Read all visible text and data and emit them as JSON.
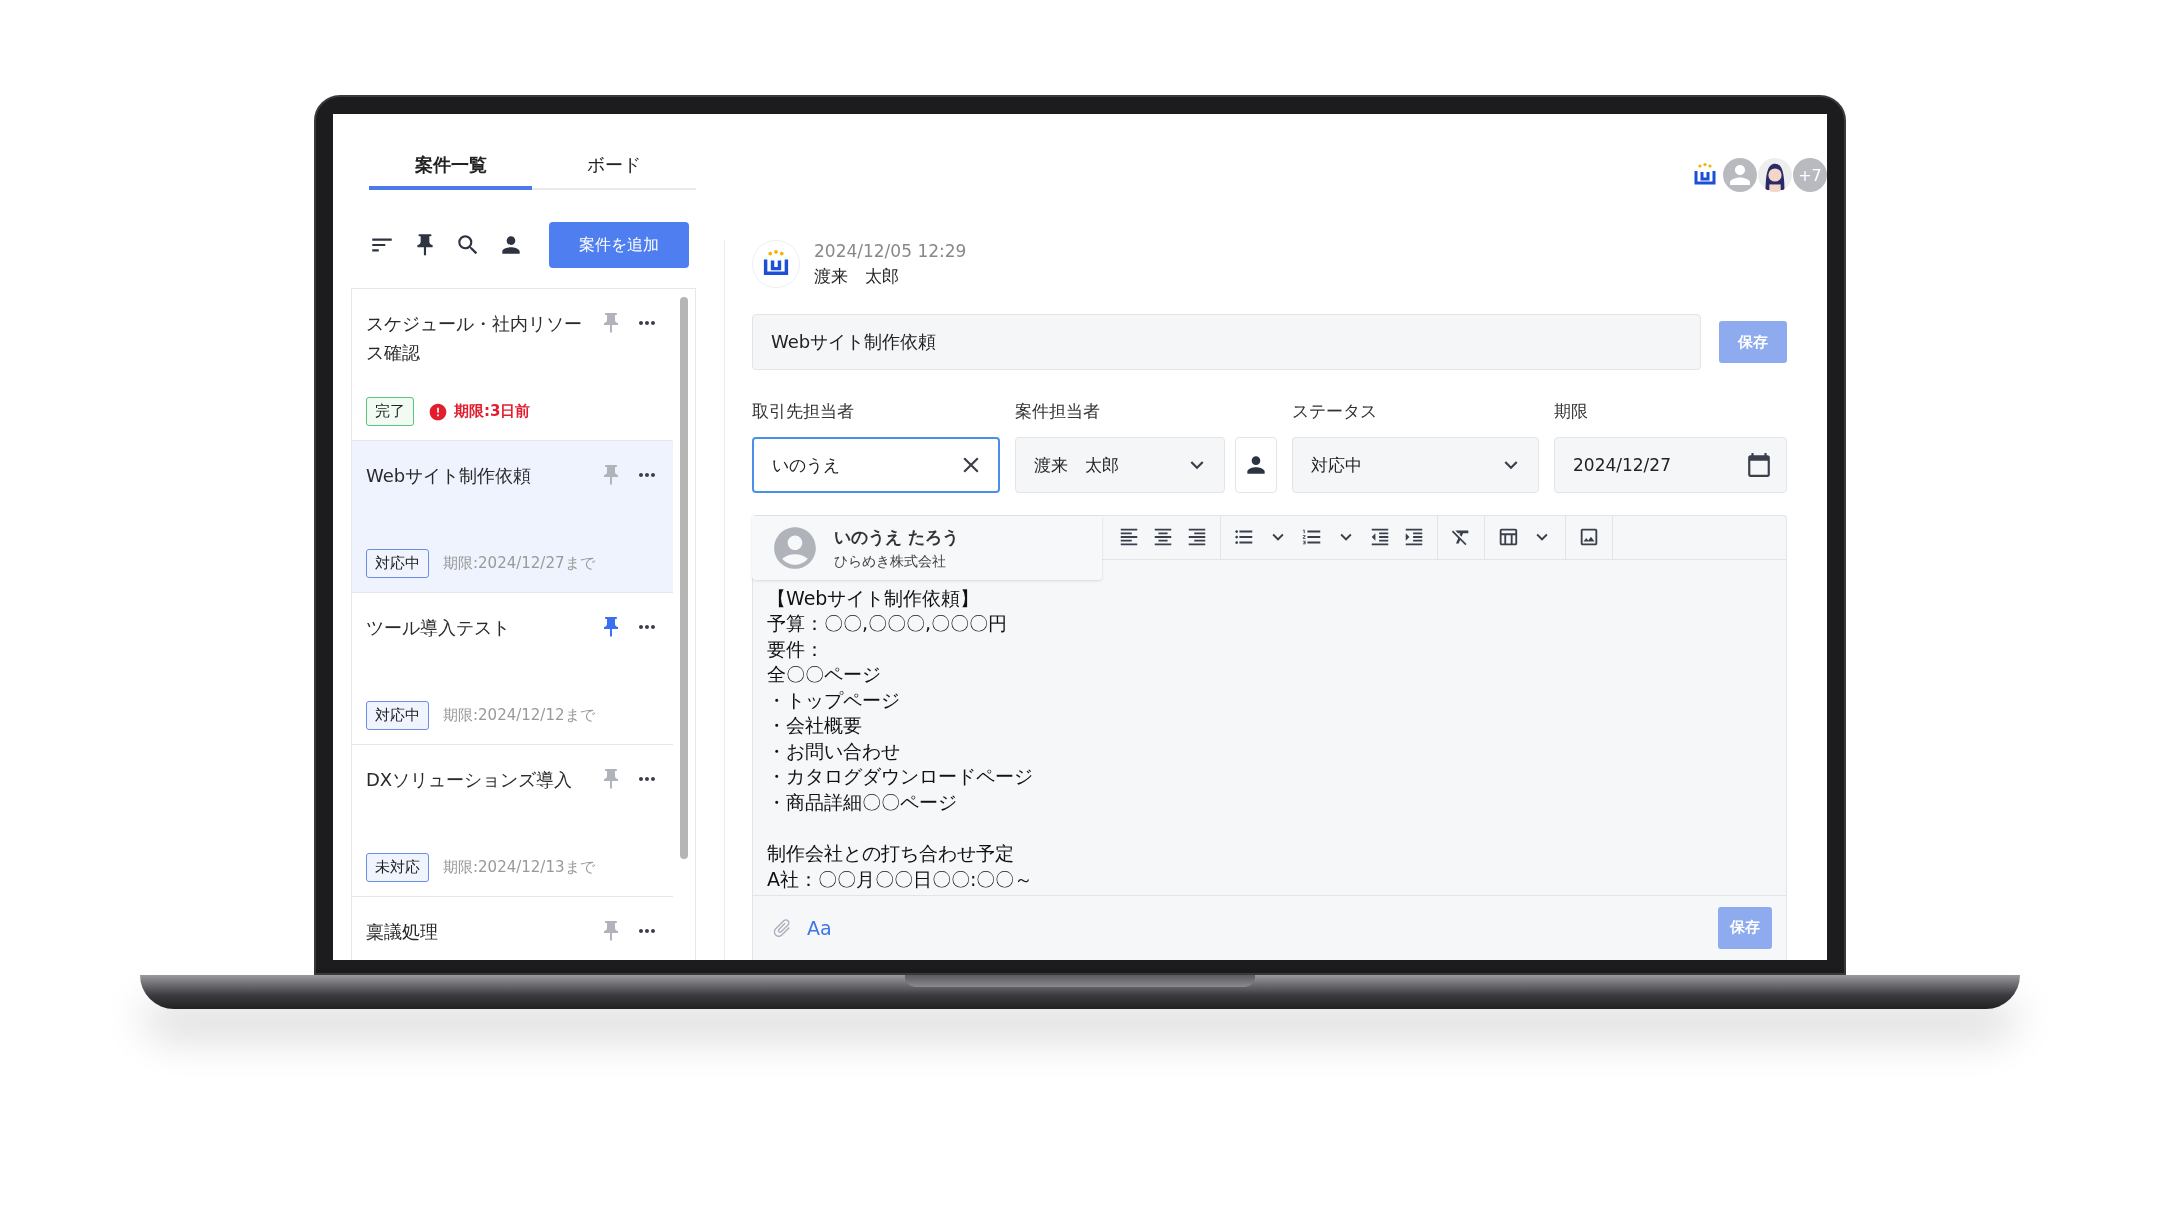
{
  "tabs": [
    {
      "label": "案件一覧",
      "selected": true
    },
    {
      "label": "ボード",
      "selected": false
    }
  ],
  "add_button": "案件を追加",
  "cases": [
    {
      "title": "スケジュール・社内リソース確認",
      "pinned": false,
      "selected": false,
      "status": {
        "label": "完了",
        "kind": "done"
      },
      "due": {
        "text": "期限:3日前",
        "kind": "overdue"
      }
    },
    {
      "title": "Webサイト制作依頼",
      "pinned": false,
      "selected": true,
      "status": {
        "label": "対応中",
        "kind": "open"
      },
      "due": {
        "text": "期限:2024/12/27まで",
        "kind": "normal"
      }
    },
    {
      "title": "ツール導入テスト",
      "pinned": true,
      "selected": false,
      "status": {
        "label": "対応中",
        "kind": "open"
      },
      "due": {
        "text": "期限:2024/12/12まで",
        "kind": "normal"
      }
    },
    {
      "title": "DXソリューションズ導入",
      "pinned": false,
      "selected": false,
      "status": {
        "label": "未対応",
        "kind": "open"
      },
      "due": {
        "text": "期限:2024/12/13まで",
        "kind": "normal"
      }
    },
    {
      "title": "稟議処理",
      "pinned": false,
      "selected": false
    }
  ],
  "members": [
    {
      "kind": "logo"
    },
    {
      "kind": "user"
    },
    {
      "kind": "person"
    },
    {
      "kind": "count",
      "label": "+7"
    }
  ],
  "detail": {
    "author": {
      "date": "2024/12/05 12:29",
      "name": "渡来　太郎"
    },
    "title": "Webサイト制作依頼",
    "save": {
      "label": "保存",
      "disabled": true
    },
    "fields": [
      {
        "label": "取引先担当者",
        "value": "いのうえ",
        "kind": "search",
        "focused": true,
        "person_picker": false
      },
      {
        "label": "案件担当者",
        "value": "渡来　太郎",
        "kind": "select",
        "focused": false,
        "person_picker": true
      },
      {
        "label": "ステータス",
        "value": "対応中",
        "kind": "select",
        "focused": false,
        "person_picker": false
      },
      {
        "label": "期限",
        "value": "2024/12/27",
        "kind": "date",
        "focused": false,
        "person_picker": false
      }
    ],
    "suggestion": {
      "name": "いのうえ たろう",
      "company": "ひらめき株式会社"
    },
    "body": [
      [
        "【Webサイト制作依頼】",
        "予算：〇〇,〇〇〇,〇〇〇円",
        "要件：",
        "全〇〇ページ",
        "・トップページ",
        "・会社概要",
        "・お問い合わせ",
        "・カタログダウンロードページ",
        "・商品詳細〇〇ページ"
      ],
      [
        "制作会社との打ち合わせ予定",
        "A社：〇〇月〇〇日〇〇:〇〇～"
      ]
    ],
    "font_button": "Aa",
    "footer_save": {
      "label": "保存",
      "disabled": true
    }
  }
}
